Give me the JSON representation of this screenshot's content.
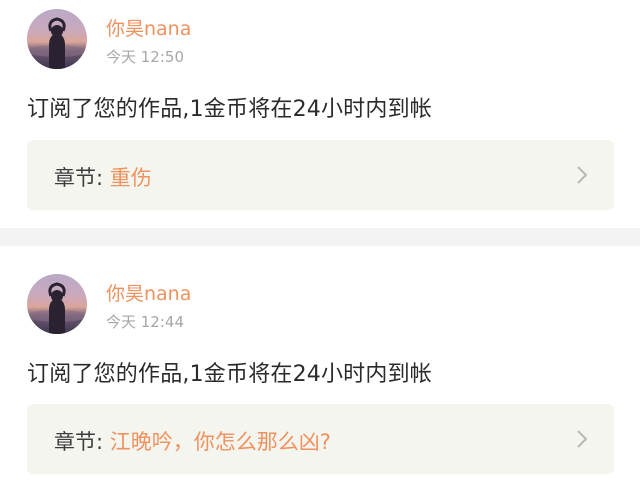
{
  "notifications": [
    {
      "username": "你昊nana",
      "time": "今天 12:50",
      "message": "订阅了您的作品,1金币将在24小时内到帐",
      "chapter_prefix": "章节: ",
      "chapter_title": "重伤",
      "avatar_icon": "user-avatar-photo",
      "chevron_icon": "chevron-right-icon"
    },
    {
      "username": "你昊nana",
      "time": "今天 12:44",
      "message": "订阅了您的作品,1金币将在24小时内到帐",
      "chapter_prefix": "章节: ",
      "chapter_title": "江晚吟，你怎么那么凶?",
      "avatar_icon": "user-avatar-photo",
      "chevron_icon": "chevron-right-icon"
    }
  ],
  "colors": {
    "accent": "#f0925e",
    "page_bg": "#f3f3f3",
    "card_bg": "#ffffff",
    "chapter_box_bg": "#f5f5f0",
    "time_text": "#a7a7a7",
    "body_text": "#2b2b2b"
  }
}
